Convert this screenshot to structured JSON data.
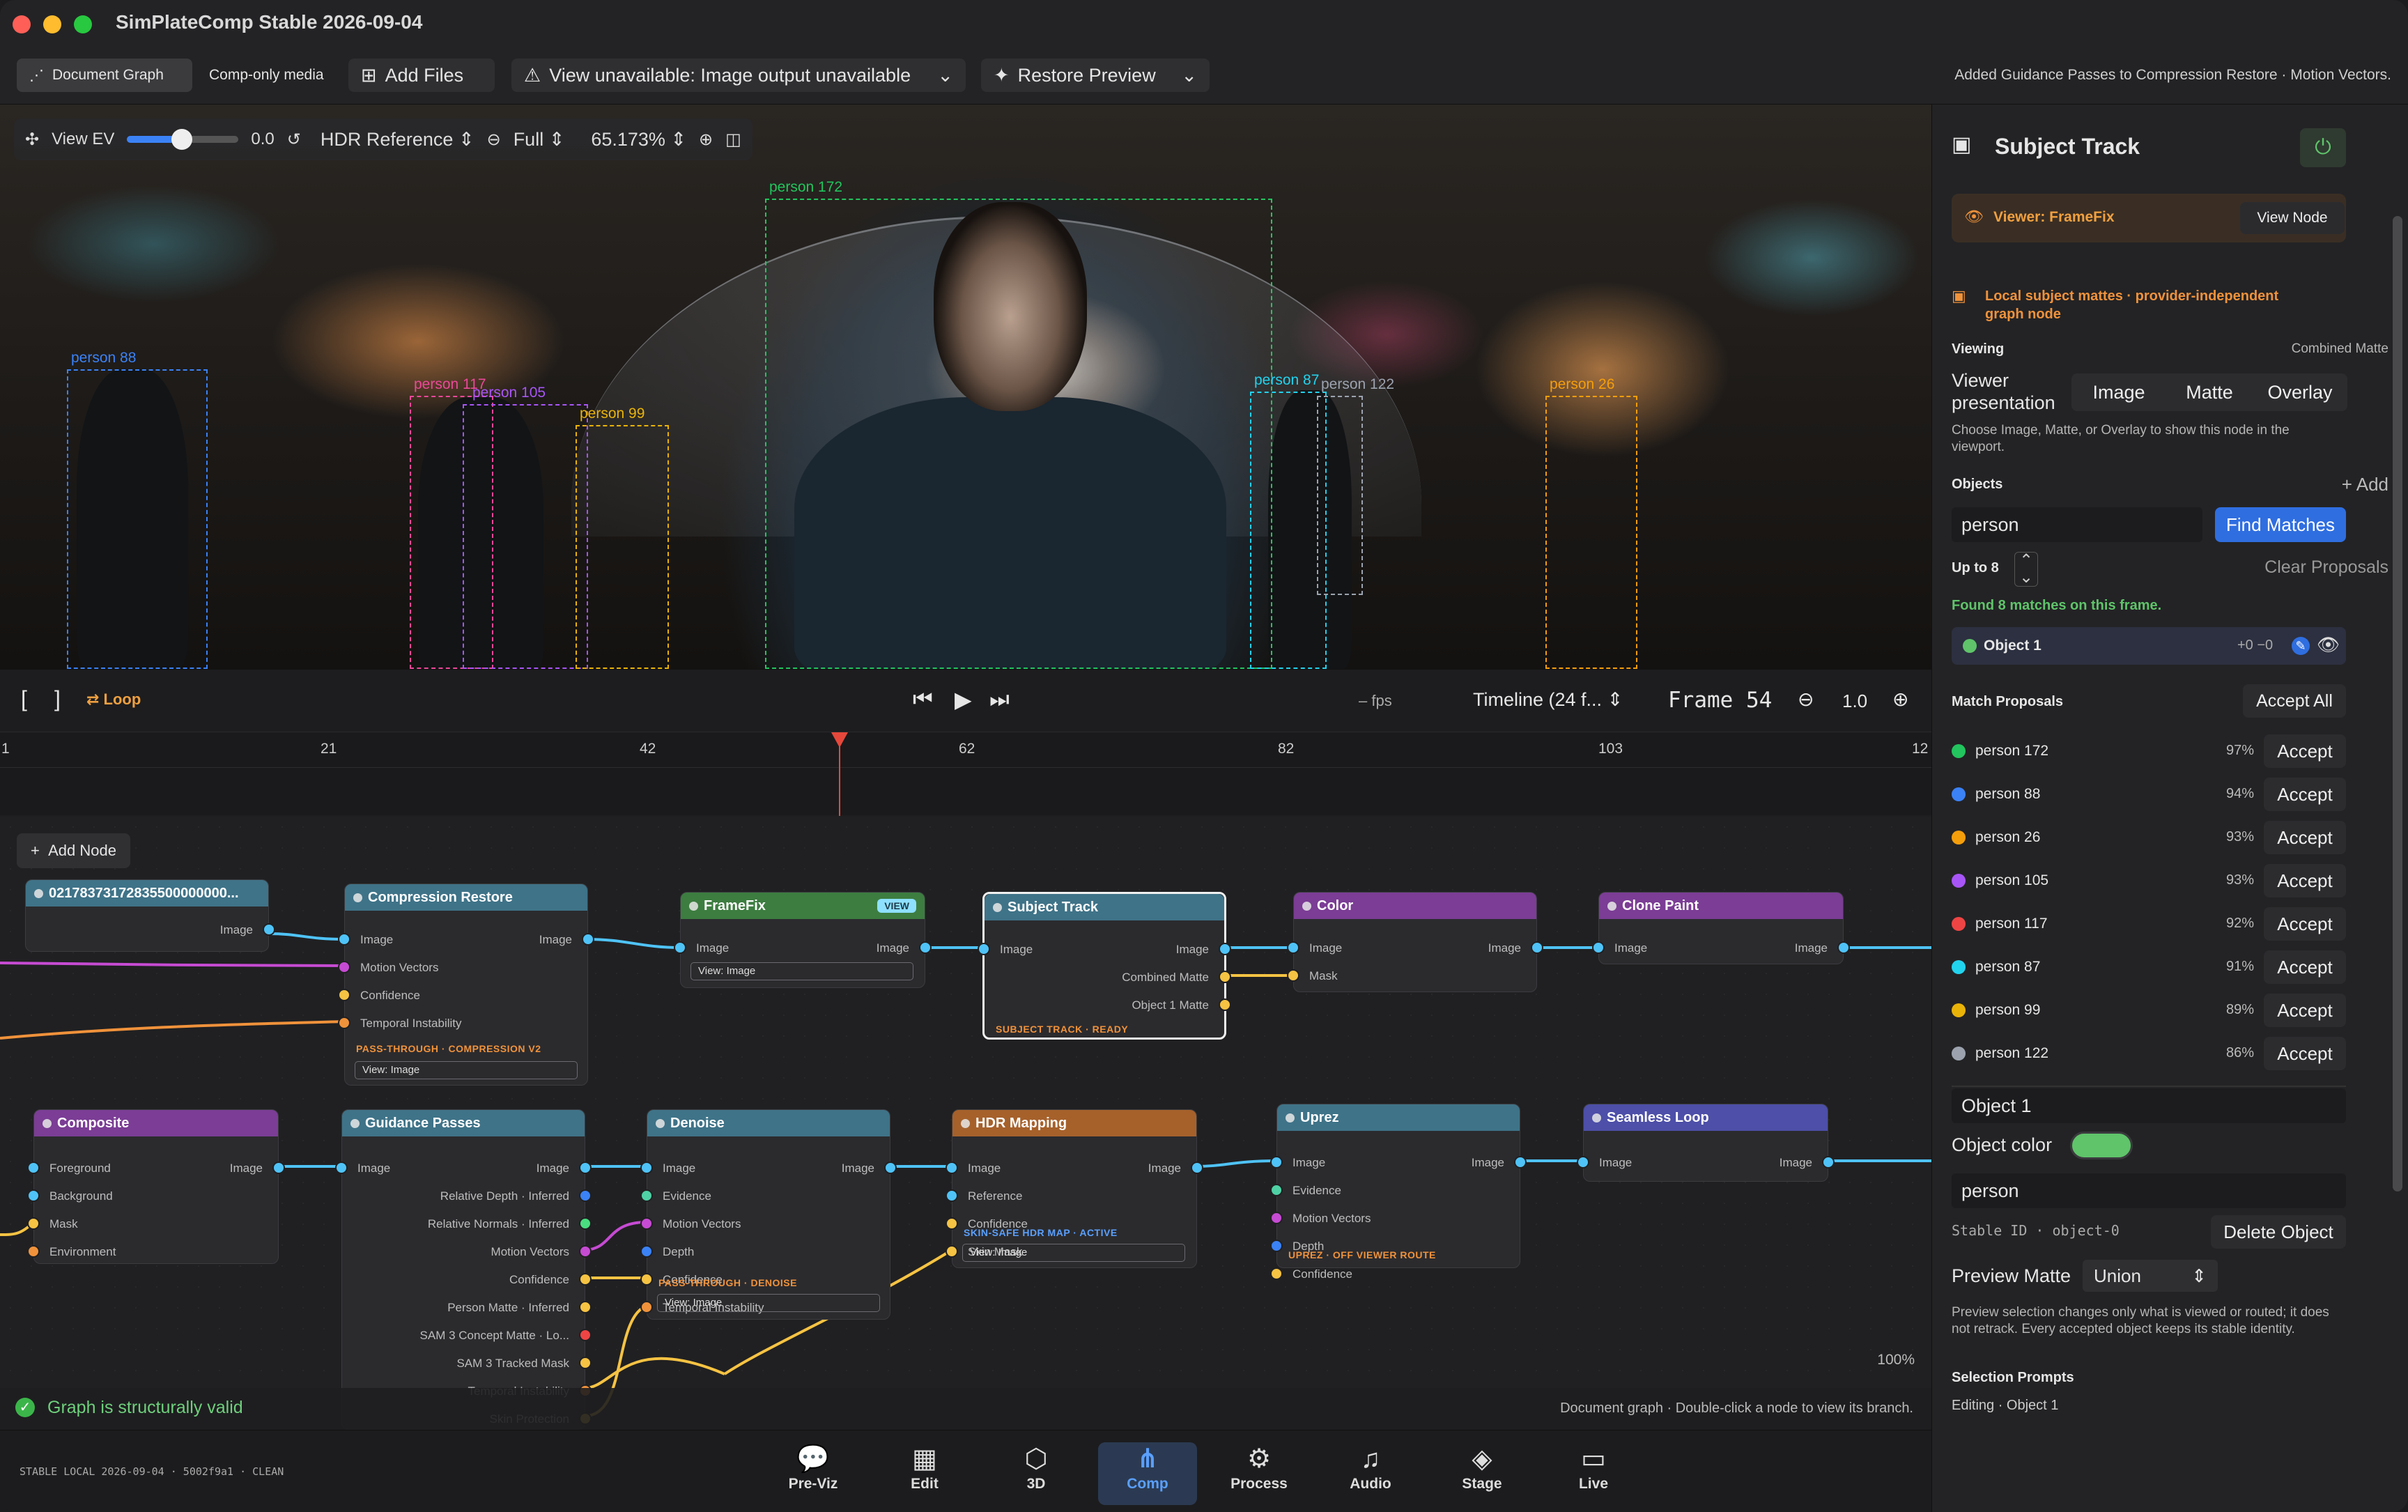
{
  "app": {
    "title": "SimPlateComp Stable 2026-09-04"
  },
  "toolbar": {
    "document_graph": "Document Graph",
    "comp_only": "Comp-only media",
    "add_files": "Add Files",
    "view_unavailable": "View unavailable: Image output unavailable",
    "restore_preview": "Restore Preview",
    "notice": "Added Guidance Passes to Compression Restore · Motion Vectors."
  },
  "viewer": {
    "view_ev_label": "View EV",
    "view_ev_value": 0.5,
    "ev_readout": "0.0",
    "display": "HDR Reference",
    "resolution": "Full",
    "zoom": "65.173%",
    "boxes": [
      {
        "label": "person 88",
        "color": "#3b82f6"
      },
      {
        "label": "person 117",
        "color": "#ec4899"
      },
      {
        "label": "person 105",
        "color": "#a855f7"
      },
      {
        "label": "person 99",
        "color": "#eab308"
      },
      {
        "label": "person 172",
        "color": "#22c55e"
      },
      {
        "label": "person 87",
        "color": "#22d3ee"
      },
      {
        "label": "person 122",
        "color": "#9ca3af"
      },
      {
        "label": "person 26",
        "color": "#f59e0b"
      }
    ]
  },
  "transport": {
    "loop": "Loop",
    "fps": "– fps",
    "timeline": "Timeline (24 f...",
    "frame_label": "Frame 54",
    "zoom": "1.0"
  },
  "ruler": {
    "ticks": [
      "1",
      "21",
      "42",
      "62",
      "82",
      "103",
      "12"
    ],
    "playhead_frame": 54
  },
  "graph": {
    "add_node": "Add Node",
    "zoom": "100%",
    "valid": "Graph is structurally valid",
    "hint": "Document graph · Double-click a node to view its branch.",
    "nodes": {
      "source": {
        "title": "02178373172835500000000...",
        "out": "Image"
      },
      "compression": {
        "title": "Compression Restore",
        "in": [
          "Image",
          "Motion Vectors",
          "Confidence",
          "Temporal Instability"
        ],
        "out": "Image",
        "status": "PASS-THROUGH · COMPRESSION V2",
        "view": "View: Image"
      },
      "framefix": {
        "title": "FrameFix",
        "badge": "VIEW",
        "in": "Image",
        "out": "Image",
        "view": "View: Image"
      },
      "subject": {
        "title": "Subject Track",
        "in": "Image",
        "outs": [
          "Image",
          "Combined Matte",
          "Object 1 Matte"
        ],
        "status": "SUBJECT TRACK · READY"
      },
      "color": {
        "title": "Color",
        "in": [
          "Image",
          "Mask"
        ],
        "out": "Image"
      },
      "clone": {
        "title": "Clone Paint",
        "in": "Image",
        "out": "Image"
      },
      "composite": {
        "title": "Composite",
        "in": [
          "Foreground",
          "Background",
          "Mask",
          "Environment"
        ],
        "out": "Image"
      },
      "guidance": {
        "title": "Guidance Passes",
        "in": "Image",
        "outs": [
          "Image",
          "Relative Depth · Inferred",
          "Relative Normals · Inferred",
          "Motion Vectors",
          "Confidence",
          "Person Matte · Inferred",
          "SAM 3 Concept Matte · Lo...",
          "SAM 3 Tracked Mask",
          "Temporal Instability",
          "Skin Protection"
        ]
      },
      "denoise": {
        "title": "Denoise",
        "in": [
          "Image",
          "Evidence",
          "Motion Vectors",
          "Depth",
          "Confidence",
          "Temporal Instability"
        ],
        "out": "Image",
        "status": "PASS-THROUGH · DENOISE",
        "view": "View: Image"
      },
      "hdr": {
        "title": "HDR Mapping",
        "in": [
          "Image",
          "Reference",
          "Confidence",
          "Skin Mask"
        ],
        "out": "Image",
        "status": "SKIN-SAFE HDR MAP · ACTIVE",
        "view": "View: Image"
      },
      "uprez": {
        "title": "Uprez",
        "in": [
          "Image",
          "Evidence",
          "Motion Vectors",
          "Depth",
          "Confidence"
        ],
        "out": "Image",
        "status": "UPREZ · OFF VIEWER ROUTE"
      },
      "seamless": {
        "title": "Seamless Loop",
        "in": "Image",
        "out": "Image"
      }
    }
  },
  "footer": {
    "build": "STABLE LOCAL 2026-09-04 · 5002f9a1 · CLEAN",
    "nav": [
      "Pre-Viz",
      "Edit",
      "3D",
      "Comp",
      "Process",
      "Audio",
      "Stage",
      "Live"
    ]
  },
  "panel": {
    "title": "Subject Track",
    "viewer_label": "Viewer: FrameFix",
    "view_node": "View Node",
    "mattes_note": "Local subject mattes · provider-independent graph node",
    "viewing": "Viewing",
    "viewing_value": "Combined Matte",
    "presentation_label": "Viewer presentation",
    "presentation_opts": [
      "Image",
      "Matte",
      "Overlay"
    ],
    "presentation_hint": "Choose Image, Matte, or Overlay to show this node in the viewport.",
    "objects": "Objects",
    "add": "Add",
    "query": "person",
    "find": "Find Matches",
    "up_to": "Up to 8",
    "clear": "Clear Proposals",
    "found": "Found 8 matches on this frame.",
    "object1": "Object 1",
    "object1_offset": "+0 −0",
    "proposals_label": "Match Proposals",
    "accept_all": "Accept All",
    "accept": "Accept",
    "proposals": [
      {
        "name": "person 172",
        "pct": "97%",
        "color": "#22c55e"
      },
      {
        "name": "person 88",
        "pct": "94%",
        "color": "#3b82f6"
      },
      {
        "name": "person 26",
        "pct": "93%",
        "color": "#f59e0b"
      },
      {
        "name": "person 105",
        "pct": "93%",
        "color": "#a855f7"
      },
      {
        "name": "person 117",
        "pct": "92%",
        "color": "#ef4444"
      },
      {
        "name": "person 87",
        "pct": "91%",
        "color": "#22d3ee"
      },
      {
        "name": "person 99",
        "pct": "89%",
        "color": "#eab308"
      },
      {
        "name": "person 122",
        "pct": "86%",
        "color": "#9ca3af"
      }
    ],
    "object_name": "Object 1",
    "object_color_label": "Object color",
    "object_color": "#5fc46a",
    "object_prompt": "person",
    "stable_id": "Stable ID · object-0",
    "delete": "Delete Object",
    "preview_matte_label": "Preview Matte",
    "preview_matte": "Union",
    "preview_hint": "Preview selection changes only what is viewed or routed; it does not retrack. Every accepted object keeps its stable identity.",
    "selection_prompts": "Selection Prompts",
    "editing": "Editing · Object 1"
  }
}
